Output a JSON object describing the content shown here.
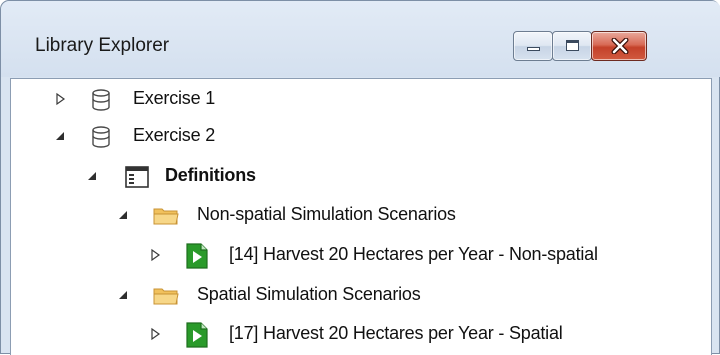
{
  "window": {
    "title": "Library Explorer",
    "buttons": {
      "minimize": "minimize",
      "maximize": "maximize",
      "close": "close"
    }
  },
  "tree": {
    "items": [
      {
        "label": "Exercise 1",
        "expanded": false,
        "icon": "database-icon"
      },
      {
        "label": "Exercise 2",
        "expanded": true,
        "icon": "database-icon"
      },
      {
        "label": "Definitions",
        "expanded": true,
        "icon": "definitions-icon"
      },
      {
        "label": "Non-spatial Simulation Scenarios",
        "expanded": true,
        "icon": "folder-icon"
      },
      {
        "label": "[14] Harvest 20 Hectares per Year - Non-spatial",
        "expanded": false,
        "icon": "scenario-icon"
      },
      {
        "label": "Spatial Simulation Scenarios",
        "expanded": true,
        "icon": "folder-icon"
      },
      {
        "label": "[17] Harvest 20 Hectares per Year - Spatial",
        "expanded": false,
        "icon": "scenario-icon"
      }
    ]
  },
  "colors": {
    "frame": "#d9e4f1",
    "close_button": "#c4412a",
    "folder": "#e8b54d",
    "scenario_green": "#2a9a2a"
  }
}
